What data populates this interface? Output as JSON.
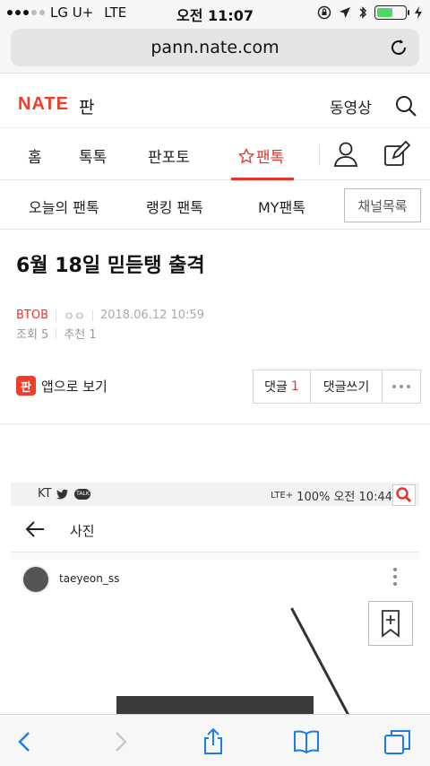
{
  "status_bar": {
    "carrier": "LG U+",
    "network": "LTE",
    "time": "오전 11:07"
  },
  "browser": {
    "url": "pann.nate.com"
  },
  "header": {
    "logo": "NATE",
    "logo_sub": "판",
    "video_link": "동영상"
  },
  "main_nav": {
    "tabs": [
      "홈",
      "톡톡",
      "판포토",
      "팬톡"
    ],
    "active_tab": "팬톡"
  },
  "sub_nav": {
    "items": [
      "오늘의 팬톡",
      "랭킹 팬톡",
      "MY팬톡"
    ],
    "channel_button": "채널목록"
  },
  "article": {
    "title": "6월 18일 믿듣탱 출격",
    "category": "BTOB",
    "author": "ㅇㅇ",
    "date": "2018.06.12 10:59",
    "views_label": "조회 5",
    "likes_label": "추천 1",
    "app_view": "앱으로 보기",
    "app_icon_text": "판",
    "comment_label": "댓글",
    "comment_count": "1",
    "write_comment": "댓글쓰기"
  },
  "embedded_screenshot": {
    "status_left": "KT",
    "status_right": "100% 오전 10:44",
    "status_network": "LTE+",
    "status_talk": "TALK",
    "header_title": "사진",
    "username": "taeyeon_ss"
  },
  "colors": {
    "accent": "#e8352b",
    "logo": "#f23c2a",
    "ios_blue": "#1a7cf5"
  }
}
